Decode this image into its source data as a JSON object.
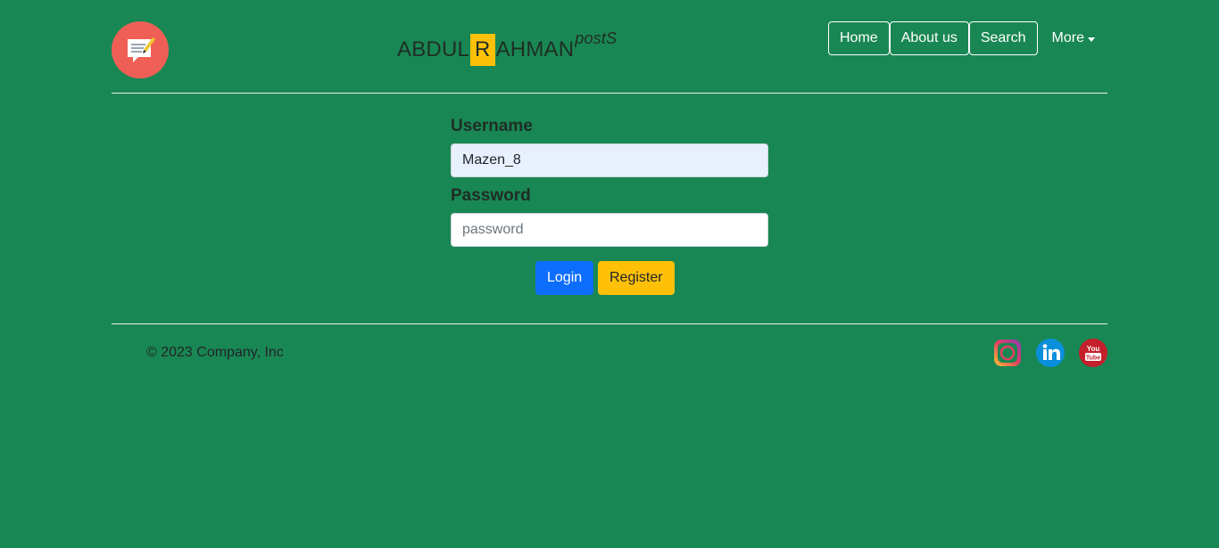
{
  "header": {
    "logo_icon": "notepad-chat-icon",
    "brand": {
      "part1": "ABDUL",
      "highlight": "R",
      "part2": "AHMAN",
      "suffix": "postS"
    },
    "nav": [
      {
        "label": "Home"
      },
      {
        "label": "About us"
      },
      {
        "label": "Search"
      }
    ],
    "more_label": "More"
  },
  "form": {
    "username_label": "Username",
    "username_value": "Mazen_8",
    "password_label": "Password",
    "password_placeholder": "password",
    "login_label": "Login",
    "register_label": "Register"
  },
  "footer": {
    "copyright": "© 2023 Company, Inc",
    "social": [
      {
        "icon": "instagram-icon"
      },
      {
        "icon": "linkedin-icon"
      },
      {
        "icon": "youtube-icon"
      }
    ]
  },
  "colors": {
    "background": "#198754",
    "logo": "#ef5f55",
    "highlight": "#ffc107",
    "login": "#0d6efd",
    "register": "#ffc107"
  }
}
